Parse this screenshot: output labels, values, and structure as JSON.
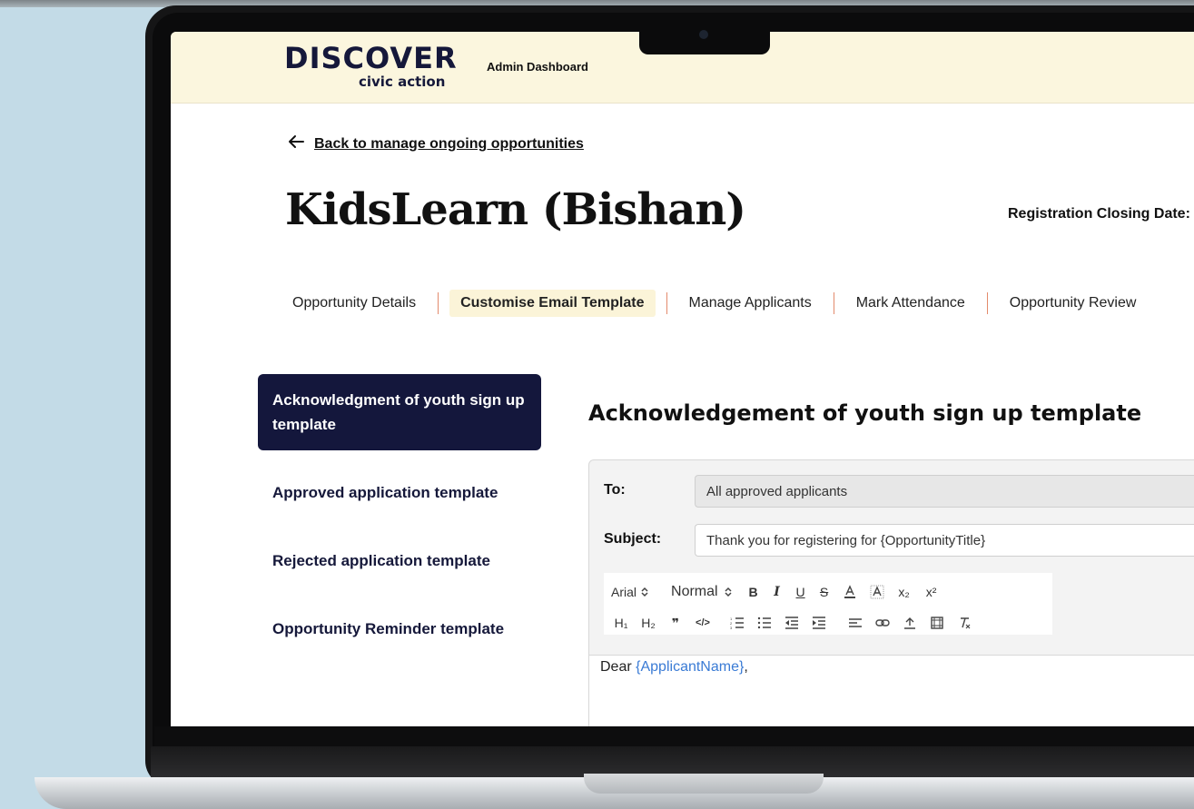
{
  "header": {
    "logo_word": "DISCOVER",
    "logo_sub": "civic action",
    "admin_link": "Admin Dashboard"
  },
  "back_link": "Back to manage ongoing opportunities",
  "page_title": "KidsLearn (Bishan)",
  "closing_label": "Registration Closing Date:",
  "tabs": [
    {
      "label": "Opportunity Details"
    },
    {
      "label": "Customise Email Template"
    },
    {
      "label": "Manage Applicants"
    },
    {
      "label": "Mark Attendance"
    },
    {
      "label": "Opportunity Review"
    }
  ],
  "sidebar": {
    "items": [
      {
        "label": "Acknowledgment of youth sign up template"
      },
      {
        "label": "Approved application template"
      },
      {
        "label": "Rejected application template"
      },
      {
        "label": "Opportunity Reminder template"
      }
    ]
  },
  "template": {
    "title": "Acknowledgement of youth sign up template",
    "to_label": "To:",
    "to_value": "All approved applicants",
    "subject_label": "Subject:",
    "subject_value": "Thank you for registering for {OpportunityTitle}",
    "body_greeting": "Dear",
    "body_placeholder": "{ApplicantName}",
    "body_punct": ","
  },
  "toolbar": {
    "font": "Arial",
    "size": "Normal",
    "bold": "B",
    "italic": "I",
    "underline": "U",
    "strike": "S",
    "h1": "H₁",
    "h2": "H₂",
    "quote": "❞",
    "code": "</>",
    "subscript": "x₂",
    "superscript": "x²"
  },
  "colors": {
    "header_bg": "#fbf6de",
    "nav_active_bg": "#14173c",
    "tab_active_bg": "#fbf4d8",
    "tab_separator": "#e38a6c",
    "placeholder": "#3a7bd5"
  }
}
